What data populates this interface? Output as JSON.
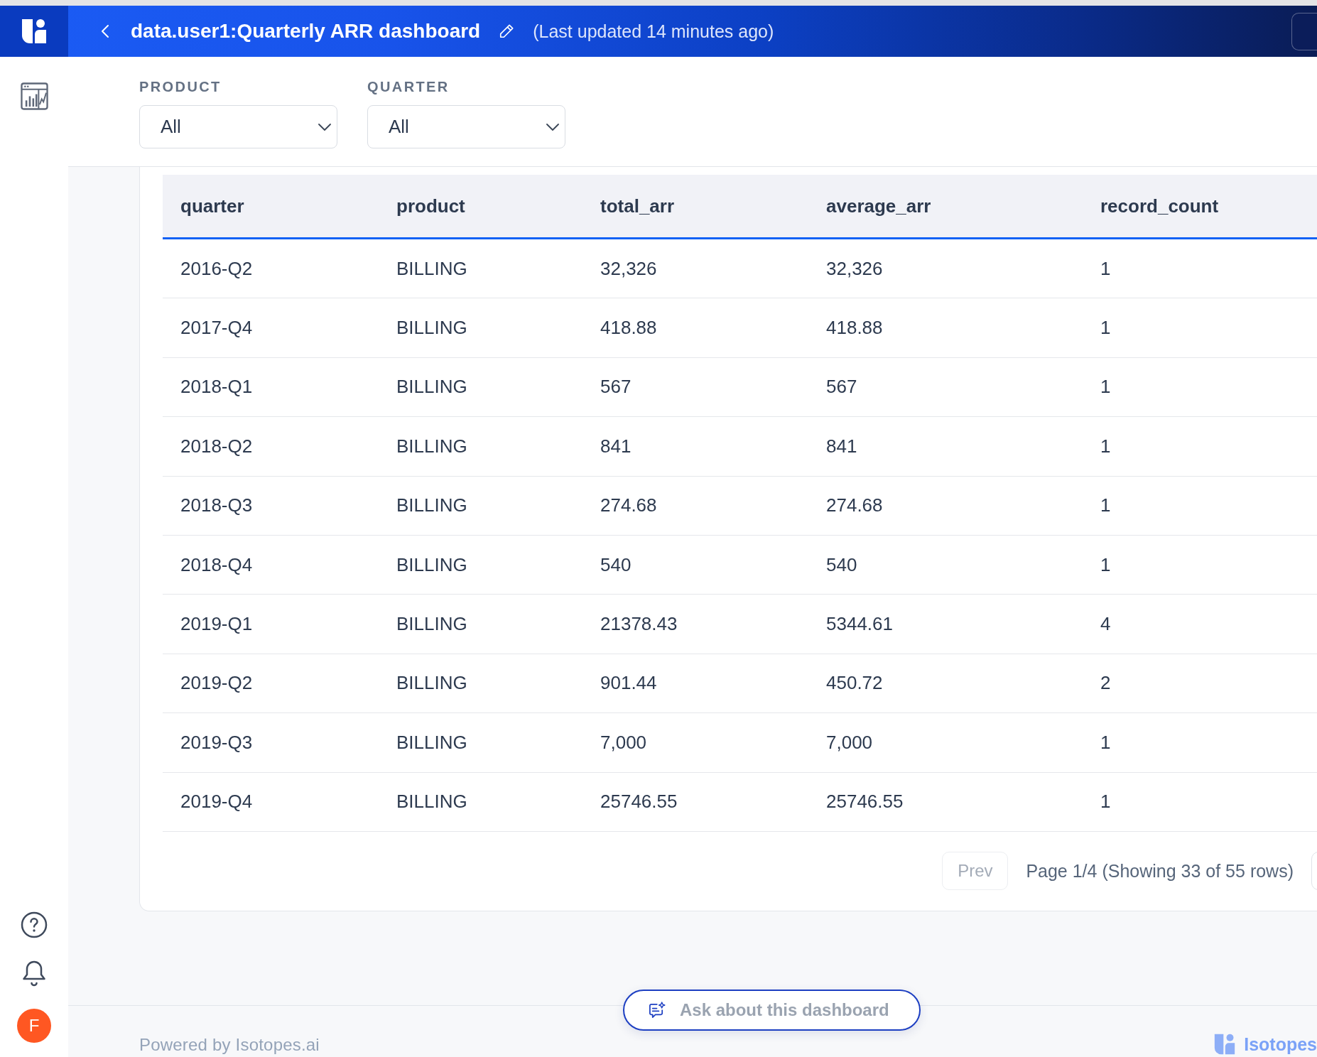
{
  "header": {
    "title": "data.user1:Quarterly ARR dashboard",
    "last_updated": "(Last updated 14 minutes ago)"
  },
  "sidebar": {
    "user_initial": "F"
  },
  "filters": [
    {
      "label": "PRODUCT",
      "value": "All"
    },
    {
      "label": "QUARTER",
      "value": "All"
    }
  ],
  "table": {
    "columns": [
      "quarter",
      "product",
      "total_arr",
      "average_arr",
      "record_count"
    ],
    "rows": [
      [
        "2016-Q2",
        "BILLING",
        "32,326",
        "32,326",
        "1"
      ],
      [
        "2017-Q4",
        "BILLING",
        "418.88",
        "418.88",
        "1"
      ],
      [
        "2018-Q1",
        "BILLING",
        "567",
        "567",
        "1"
      ],
      [
        "2018-Q2",
        "BILLING",
        "841",
        "841",
        "1"
      ],
      [
        "2018-Q3",
        "BILLING",
        "274.68",
        "274.68",
        "1"
      ],
      [
        "2018-Q4",
        "BILLING",
        "540",
        "540",
        "1"
      ],
      [
        "2019-Q1",
        "BILLING",
        "21378.43",
        "5344.61",
        "4"
      ],
      [
        "2019-Q2",
        "BILLING",
        "901.44",
        "450.72",
        "2"
      ],
      [
        "2019-Q3",
        "BILLING",
        "7,000",
        "7,000",
        "1"
      ],
      [
        "2019-Q4",
        "BILLING",
        "25746.55",
        "25746.55",
        "1"
      ]
    ]
  },
  "pagination": {
    "prev": {
      "label": "Prev",
      "disabled": true
    },
    "status": "Page 1/4 (Showing 33 of 55 rows)"
  },
  "ask_button": {
    "label": "Ask about this dashboard"
  },
  "footer": {
    "powered_by": "Powered by Isotopes.ai",
    "brand": "Isotopes"
  }
}
